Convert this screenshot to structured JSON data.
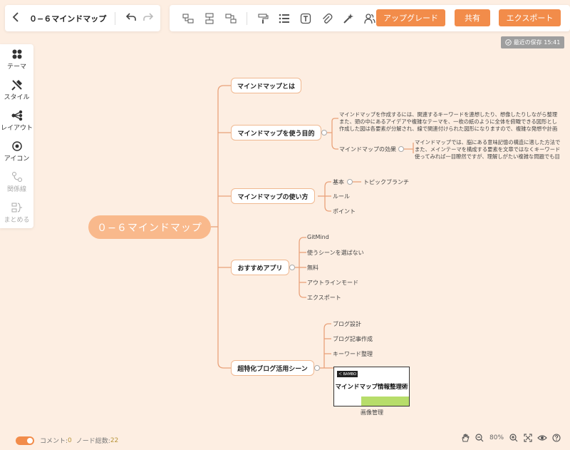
{
  "titlebar": {
    "title": "０−６マインドマップ",
    "back_icon": "chevron-left-icon",
    "undo_icon": "undo-icon",
    "redo_icon": "redo-icon"
  },
  "toolbar": {
    "tools": [
      "add-child-node-icon",
      "add-sibling-node-icon",
      "add-parent-node-icon",
      "format-painter-icon",
      "list-icon",
      "text-icon",
      "attachment-icon",
      "magic-wand-icon",
      "people-icon",
      "save-icon"
    ],
    "upgrade_label": "アップグレード",
    "share_label": "共有",
    "export_label": "エクスポート"
  },
  "save_status": "最近の保存 15:41",
  "sidebar": {
    "items": [
      {
        "label": "テーマ",
        "icon": "theme-icon"
      },
      {
        "label": "スタイル",
        "icon": "style-icon"
      },
      {
        "label": "レイアウト",
        "icon": "layout-icon"
      },
      {
        "label": "アイコン",
        "icon": "icon-icon"
      },
      {
        "label": "関係線",
        "icon": "relation-line-icon"
      },
      {
        "label": "まとめる",
        "icon": "summary-icon"
      }
    ]
  },
  "mindmap": {
    "root": "０−６マインドマップ",
    "branches": [
      {
        "label": "マインドマップとは"
      },
      {
        "label": "マインドマップを使う目的",
        "notes": [
          "マインドマップを作成するには、関連するキーワードを連想したり、想像したりしながら整理",
          "また、頭の中にあるアイデアや複雑なテーマを、一枚の紙のように全体を俯瞰できる図形とし",
          "作成した図は各要素が分解され、線で関連付けられた図形になりますので、複雑な発想や計画"
        ],
        "sub": "マインドマップの効果",
        "sub_notes": [
          "マインドマップでは、脳にある意味記憶の構造に適した方法で",
          "また、メインテーマを構成する要素を文章ではなくキーワード",
          "使ってみれば一目瞭然ですが、理解しがたい複雑な問題でも目"
        ]
      },
      {
        "label": "マインドマップの使い方",
        "children": [
          "基本",
          "ルール",
          "ポイント"
        ],
        "grandchild": "トピックブランチ"
      },
      {
        "label": "おすすめアプリ",
        "children": [
          "GitMind",
          "使うシーンを選ばない",
          "無料",
          "アウトラインモード",
          "エクスポート"
        ]
      },
      {
        "label": "超特化ブログ活用シーン",
        "children": [
          "ブログ設計",
          "ブログ記事作成",
          "キーワード整理"
        ],
        "image": {
          "tag": "＜ BAMBO",
          "title": "マインドマップ情報整理術",
          "caption": "画像管理"
        }
      }
    ]
  },
  "footer": {
    "comment_label": "コメント: ",
    "comment_count": "0",
    "node_label": "ノード総数: ",
    "node_count": "22",
    "zoom": "80%",
    "icons": [
      "hand-icon",
      "zoom-out-icon",
      "zoom-in-icon",
      "fit-screen-icon",
      "eye-icon",
      "help-icon"
    ]
  },
  "colors": {
    "accent": "#f28c4a",
    "background": "#fdeee2",
    "root": "#f9b98c",
    "line": "#e9a27a",
    "counter": "#b8963c"
  }
}
